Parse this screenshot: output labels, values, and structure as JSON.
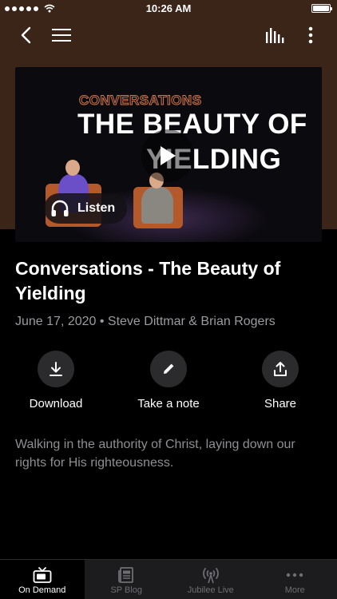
{
  "status_bar": {
    "time": "10:26 AM"
  },
  "nav": {
    "back_icon": "chevron-left-icon",
    "menu_icon": "hamburger-icon",
    "equalizer_icon": "equalizer-icon",
    "more_icon": "vertical-ellipsis-icon"
  },
  "hero": {
    "subtitle": "CONVERSATIONS",
    "title_line1": "THE BEAUTY OF",
    "title_line2": "YIELDING",
    "listen_label": "Listen",
    "accent_color": "#d5774a"
  },
  "episode": {
    "title": "Conversations - The Beauty of Yielding",
    "meta": "June 17, 2020 • Steve Dittmar & Brian Rogers",
    "description": "Walking in the authority of Christ, laying down our rights for His righteousness."
  },
  "actions": [
    {
      "label": "Download",
      "icon": "download-icon"
    },
    {
      "label": "Take a note",
      "icon": "pencil-icon"
    },
    {
      "label": "Share",
      "icon": "share-icon"
    }
  ],
  "tabs": [
    {
      "label": "On Demand",
      "icon": "tv-icon",
      "active": true
    },
    {
      "label": "SP Blog",
      "icon": "newspaper-icon",
      "active": false
    },
    {
      "label": "Jubilee Live",
      "icon": "broadcast-icon",
      "active": false
    },
    {
      "label": "More",
      "icon": "horizontal-ellipsis-icon",
      "active": false
    }
  ],
  "colors": {
    "header_bg": "#3b2418",
    "tab_bg": "#1c1c1e",
    "muted_text": "#9a9aa0"
  }
}
